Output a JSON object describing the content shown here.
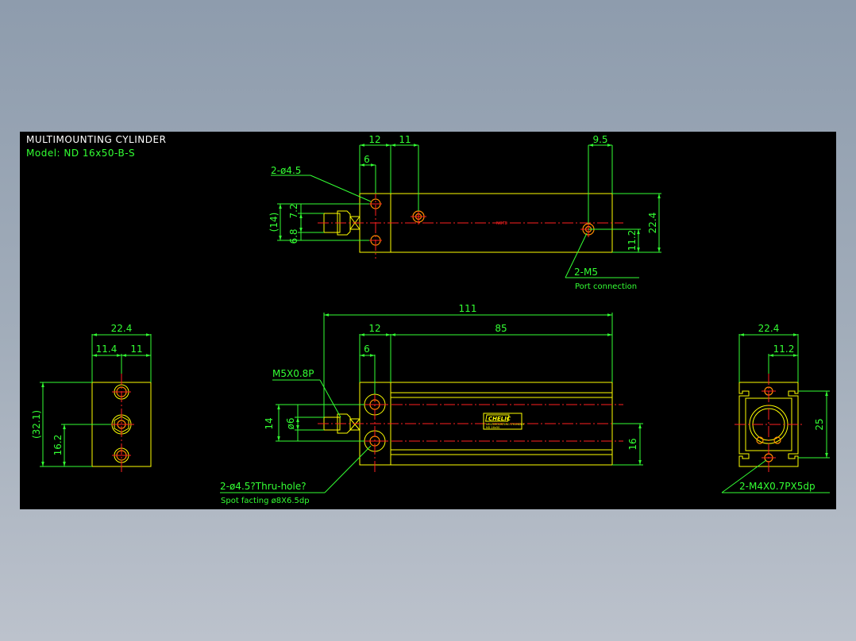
{
  "colors": {
    "background": "#000000",
    "outline": "#ffff00",
    "dimension": "#33ff33",
    "centerline": "#ff2020",
    "hole": "#ff8c00",
    "title": "#ffffff"
  },
  "title": {
    "heading": "MULTIMOUNTING CYLINDER",
    "model": "Model: ND 16x50-B-S"
  },
  "top_view": {
    "dims": {
      "d12": "12",
      "d11": "11",
      "d9_5": "9.5",
      "d6": "6",
      "d22_4": "22.4",
      "d11_2": "11.2",
      "d14": "(14)",
      "d6_8": "6.8",
      "d7_2": "7.2"
    },
    "hole_callout": "2-ø4.5",
    "port_callout": "2-M5",
    "port_note": "Port connection",
    "center_mark": "NOTE"
  },
  "front_view": {
    "dims": {
      "d111": "111",
      "d12": "12",
      "d85": "85",
      "d6": "6",
      "d14": "14",
      "dphi6": "ø6",
      "d16": "16"
    },
    "thread_callout": "M5X0.8P",
    "hole_callout": "2-ø4.5?Thru-hole?",
    "spot_facing": "Spot facting  ø8X6.5dp",
    "brand": "CHELIC",
    "nameplate_lines": [
      "MULTIMOUNTING CYLINDER",
      "ND 16x50"
    ]
  },
  "left_view": {
    "dims": {
      "d22_4": "22.4",
      "d11_4": "11.4",
      "d11": "11",
      "d32_1": "(32.1)",
      "d16_2": "16.2"
    }
  },
  "right_view": {
    "dims": {
      "d22_4": "22.4",
      "d11_2": "11.2",
      "d25": "25"
    },
    "thread_callout": "2-M4X0.7PX5dp"
  }
}
